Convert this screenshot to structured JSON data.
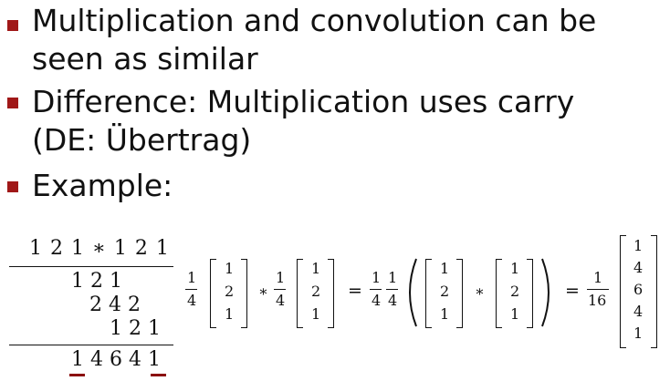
{
  "bullets": [
    {
      "line1": "Multiplication and convolution can be",
      "line2": "seen as similar"
    },
    {
      "line1": "Difference: Multiplication uses carry",
      "line2": "(DE: Übertrag)"
    },
    {
      "line1": "Example:"
    }
  ],
  "multiplication": {
    "header": "1 2 1 ∗ 1 2 1",
    "row1": "1 2 1",
    "row2": "2 4 2",
    "row3": "1 2 1",
    "result": "1 4 6 4 1"
  },
  "formula": {
    "quarter_num": "1",
    "quarter_den": "4",
    "vec": [
      "1",
      "2",
      "1"
    ],
    "star": "∗",
    "equals": "=",
    "sixteenth_num": "1",
    "sixteenth_den": "16",
    "result_vec": [
      "1",
      "4",
      "6",
      "4",
      "1"
    ]
  },
  "colors": {
    "bullet": "#a01818",
    "carry_underline": "#8b1010"
  }
}
